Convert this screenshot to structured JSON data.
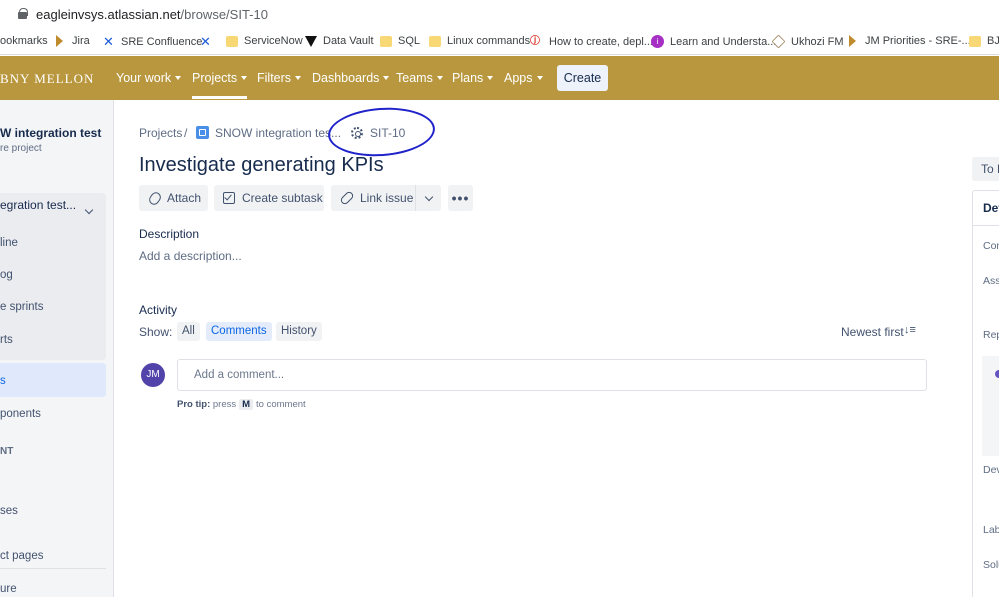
{
  "browser": {
    "url_host": "eagleinvsys.atlassian.net",
    "url_path": "/browse/SIT-10"
  },
  "bookmarks": [
    {
      "label": "ookmarks",
      "icon": "folder-icon"
    },
    {
      "label": "Jira",
      "icon": "jira-icon"
    },
    {
      "label": "SRE Confluence",
      "icon": "confluence-icon"
    },
    {
      "label": "",
      "icon": "confluence-icon"
    },
    {
      "label": "ServiceNow",
      "icon": "folder-icon"
    },
    {
      "label": "Data Vault",
      "icon": "triangle-icon"
    },
    {
      "label": "SQL",
      "icon": "folder-icon"
    },
    {
      "label": "Linux commands",
      "icon": "folder-icon"
    },
    {
      "label": "How to create, depl...",
      "icon": "page-icon"
    },
    {
      "label": "Learn and Understa...",
      "icon": "circle-icon"
    },
    {
      "label": "Ukhozi FM",
      "icon": "cube-icon"
    },
    {
      "label": "JM Priorities - SRE-...",
      "icon": "jira-icon"
    },
    {
      "label": "BJs",
      "icon": "folder-icon"
    }
  ],
  "topnav": {
    "brand": "BNY MELLON",
    "items": [
      {
        "label": "Your work",
        "active": false
      },
      {
        "label": "Projects",
        "active": true
      },
      {
        "label": "Filters",
        "active": false
      },
      {
        "label": "Dashboards",
        "active": false
      },
      {
        "label": "Teams",
        "active": false
      },
      {
        "label": "Plans",
        "active": false
      },
      {
        "label": "Apps",
        "active": false
      }
    ],
    "create_label": "Create"
  },
  "sidebar": {
    "project_name": "W integration test",
    "project_type": "re project",
    "board_name": "egration test...",
    "board_items": [
      "line",
      "og",
      "e sprints",
      "rts"
    ],
    "items": [
      "s",
      "ponents"
    ],
    "section_label": "NT",
    "lower_items": [
      "ses",
      "ct pages",
      "ure"
    ]
  },
  "breadcrumb": {
    "projects": "Projects",
    "separator": "/",
    "project": "SNOW integration tes...",
    "issue_key": "SIT-10"
  },
  "issue": {
    "title": "Investigate generating KPIs"
  },
  "actions": {
    "attach": "Attach",
    "create_subtask": "Create subtask",
    "link_issue": "Link issue"
  },
  "description": {
    "label": "Description",
    "placeholder": "Add a description..."
  },
  "activity": {
    "label": "Activity",
    "show_label": "Show:",
    "filters": [
      {
        "label": "All",
        "selected": false
      },
      {
        "label": "Comments",
        "selected": true
      },
      {
        "label": "History",
        "selected": false
      }
    ],
    "sort_label": "Newest first",
    "avatar_initials": "JM",
    "comment_placeholder": "Add a comment...",
    "protip_label": "Pro tip:",
    "protip_press": "press",
    "protip_key": "M",
    "protip_suffix": "to comment"
  },
  "right_panel": {
    "status": "To D",
    "details": "Det",
    "fields": [
      "Con",
      "Assi",
      "Rep",
      "Dev",
      "Lab",
      "Solu"
    ]
  },
  "colors": {
    "topnav_bg": "#b8973e",
    "annotation_ink": "#1f23c9",
    "link_blue": "#0c66e4",
    "avatar_bg": "#5243aa"
  }
}
